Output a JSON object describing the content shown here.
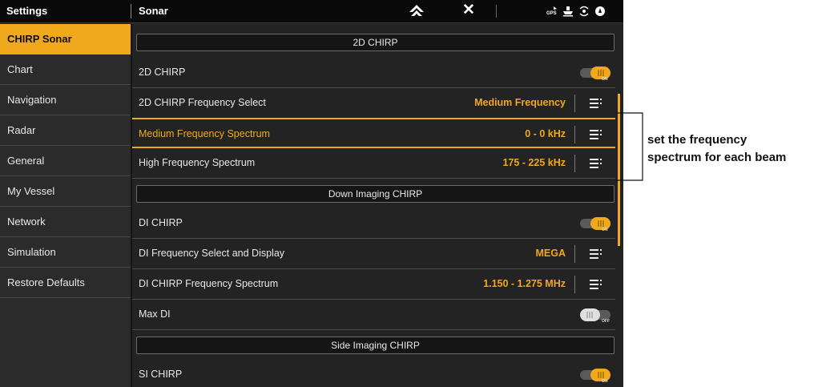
{
  "topbar": {
    "left_title": "Settings",
    "right_title": "Sonar",
    "icons": [
      "home-icon",
      "close-icon",
      "gps-icon",
      "vessel-icon",
      "sonar-icon",
      "compass-icon"
    ]
  },
  "sidebar": {
    "items": [
      {
        "label": "CHIRP Sonar",
        "active": true
      },
      {
        "label": "Chart"
      },
      {
        "label": "Navigation"
      },
      {
        "label": "Radar"
      },
      {
        "label": "General"
      },
      {
        "label": "My Vessel"
      },
      {
        "label": "Network"
      },
      {
        "label": "Simulation"
      },
      {
        "label": "Restore Defaults"
      }
    ]
  },
  "main": {
    "sections": {
      "chirp_2d": "2D CHIRP",
      "down_imaging": "Down Imaging CHIRP",
      "side_imaging": "Side Imaging CHIRP"
    },
    "rows": {
      "chirp_2d_toggle": {
        "label": "2D CHIRP",
        "state": "ON"
      },
      "chirp_2d_freq_select": {
        "label": "2D CHIRP Frequency Select",
        "value": "Medium Frequency"
      },
      "medium_freq_spectrum": {
        "label": "Medium Frequency Spectrum",
        "value": "0 - 0 kHz"
      },
      "high_freq_spectrum": {
        "label": "High Frequency Spectrum",
        "value": "175 - 225 kHz"
      },
      "di_chirp_toggle": {
        "label": "DI CHIRP",
        "state": "ON"
      },
      "di_freq_select": {
        "label": "DI Frequency Select and Display",
        "value": "MEGA"
      },
      "di_chirp_spectrum": {
        "label": "DI CHIRP Frequency Spectrum",
        "value": "1.150 - 1.275 MHz"
      },
      "max_di": {
        "label": "Max DI",
        "state": "OFF"
      },
      "si_chirp_toggle": {
        "label": "SI CHIRP",
        "state": "ON"
      }
    }
  },
  "annotation": {
    "line1": "set the frequency",
    "line2": "spectrum for each beam"
  },
  "colors": {
    "accent": "#f0a81c",
    "background": "#232323",
    "topbar": "#0a0a0a"
  }
}
